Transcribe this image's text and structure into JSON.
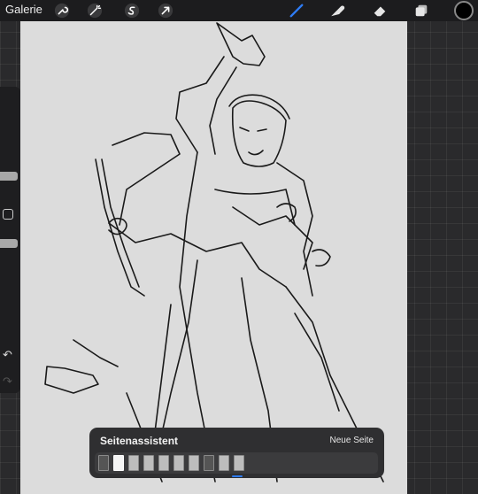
{
  "toolbar": {
    "gallery_label": "Galerie",
    "left_tools": [
      {
        "name": "wrench-icon"
      },
      {
        "name": "magic-wand-icon"
      },
      {
        "name": "selection-s-icon"
      },
      {
        "name": "transform-arrow-icon"
      }
    ],
    "right_tools": [
      {
        "name": "brush-icon",
        "active": true
      },
      {
        "name": "smudge-icon"
      },
      {
        "name": "eraser-icon"
      },
      {
        "name": "layers-icon"
      }
    ],
    "current_color": "#000000",
    "accent_color": "#2e7cf6"
  },
  "sidebar": {
    "size_slider": "brush-size",
    "opacity_slider": "brush-opacity",
    "modify_icon": "square-modify-icon",
    "undo_symbol": "↶",
    "redo_symbol": "↷"
  },
  "page_assistant": {
    "title": "Seitenassistent",
    "new_page": "Neue Seite",
    "pages": [
      {
        "kind": "dark"
      },
      {
        "kind": "active"
      },
      {
        "kind": "light"
      },
      {
        "kind": "light"
      },
      {
        "kind": "light"
      },
      {
        "kind": "light"
      },
      {
        "kind": "light"
      },
      {
        "kind": "dark"
      },
      {
        "kind": "light"
      },
      {
        "kind": "light"
      }
    ]
  }
}
